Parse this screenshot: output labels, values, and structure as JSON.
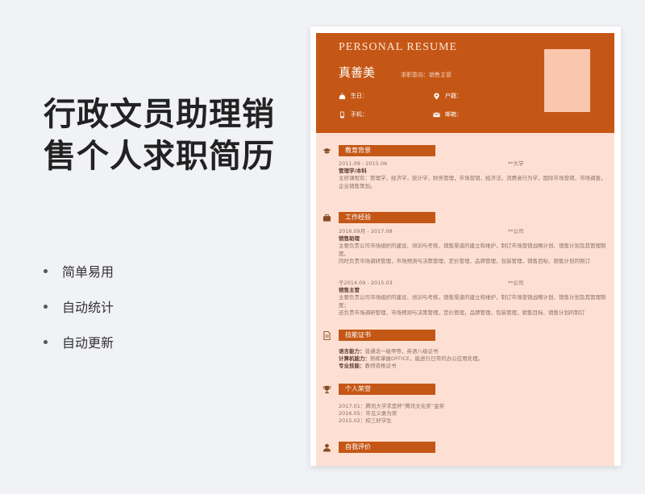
{
  "headline": {
    "line1": "行政文员助理销",
    "line2": "售个人求职简历"
  },
  "features": [
    "简单易用",
    "自动统计",
    "自动更新"
  ],
  "resume": {
    "banner": "PERSONAL  RESUME",
    "name": "真善美",
    "intent": "求职意向：销售主管",
    "fields": {
      "birth": "生日：",
      "hukou": "户籍：",
      "phone": "手机：",
      "email": "邮箱："
    },
    "education": {
      "title": "教育背景",
      "period": "2011.09 - 2015.06",
      "school": "**大学",
      "major": "管理学/本科",
      "courses": "主修课程有：管理学，经济学，统计学，财务管理，市场营销，经济法，消费者行为学，国际市场营销，市场调查，企业销售策划。"
    },
    "work": {
      "title": "工作经验",
      "jobs": [
        {
          "period": "2016.09月 - 2017.08",
          "company": "**公司",
          "role": "销售助理",
          "desc1": "主要负责公司市场组织的建设、培训与考核，销售渠道的建立和维护，制订市场营销战略计划、销售计划及其管理制度。",
          "desc2": "同时负责市场调研管理，市场预测与决策管理，定价管理、品牌管理，包装管理，销售目标、销售计划的制订"
        },
        {
          "period": "于2014.09 - 2015.03",
          "company": "**公司",
          "role": "销售主管",
          "desc1": "主要负责公司市场组织的建设、培训与考核，销售渠道的建立和维护，制订市场营销战略计划、销售计划及其管理制度；",
          "desc2": "还负责市场调研管理，市场预测与决策管理，定价管理，品牌管理，包装管理，销售目标、销售计划的制订"
        }
      ]
    },
    "skills": {
      "title": "技能证书",
      "items": [
        {
          "label": "语言能力：",
          "value": "普通话一级甲等，英语八级证书"
        },
        {
          "label": "计算机能力：",
          "value": "熟练掌握OFFICE，能进行日常的办公应用处理。"
        },
        {
          "label": "专业技能：",
          "value": "教师资格证书"
        }
      ]
    },
    "honors": {
      "title": "个人荣誉",
      "items": [
        "2017.01：腾讯大学求是杯“腾讯文化奖”金奖",
        "2016.05：市见义勇为奖",
        "2015.02：校三好学生"
      ]
    },
    "self": {
      "title": "自我评价"
    }
  },
  "colors": {
    "accent": "#c55716",
    "paper": "#fde0d3",
    "photo": "#f9c7ae"
  }
}
